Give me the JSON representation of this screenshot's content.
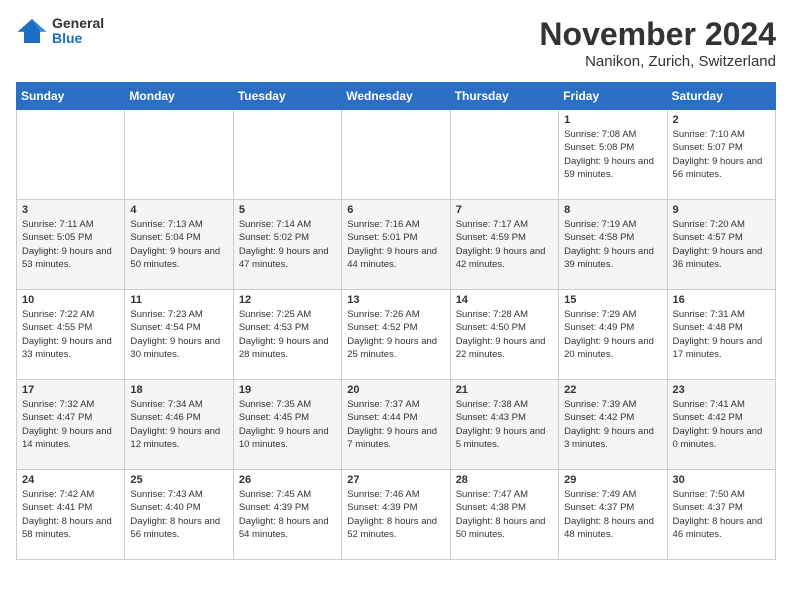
{
  "header": {
    "logo_general": "General",
    "logo_blue": "Blue",
    "month_title": "November 2024",
    "location": "Nanikon, Zurich, Switzerland"
  },
  "days_of_week": [
    "Sunday",
    "Monday",
    "Tuesday",
    "Wednesday",
    "Thursday",
    "Friday",
    "Saturday"
  ],
  "weeks": [
    [
      {
        "day": "",
        "sunrise": "",
        "sunset": "",
        "daylight": ""
      },
      {
        "day": "",
        "sunrise": "",
        "sunset": "",
        "daylight": ""
      },
      {
        "day": "",
        "sunrise": "",
        "sunset": "",
        "daylight": ""
      },
      {
        "day": "",
        "sunrise": "",
        "sunset": "",
        "daylight": ""
      },
      {
        "day": "",
        "sunrise": "",
        "sunset": "",
        "daylight": ""
      },
      {
        "day": "1",
        "sunrise": "Sunrise: 7:08 AM",
        "sunset": "Sunset: 5:08 PM",
        "daylight": "Daylight: 9 hours and 59 minutes."
      },
      {
        "day": "2",
        "sunrise": "Sunrise: 7:10 AM",
        "sunset": "Sunset: 5:07 PM",
        "daylight": "Daylight: 9 hours and 56 minutes."
      }
    ],
    [
      {
        "day": "3",
        "sunrise": "Sunrise: 7:11 AM",
        "sunset": "Sunset: 5:05 PM",
        "daylight": "Daylight: 9 hours and 53 minutes."
      },
      {
        "day": "4",
        "sunrise": "Sunrise: 7:13 AM",
        "sunset": "Sunset: 5:04 PM",
        "daylight": "Daylight: 9 hours and 50 minutes."
      },
      {
        "day": "5",
        "sunrise": "Sunrise: 7:14 AM",
        "sunset": "Sunset: 5:02 PM",
        "daylight": "Daylight: 9 hours and 47 minutes."
      },
      {
        "day": "6",
        "sunrise": "Sunrise: 7:16 AM",
        "sunset": "Sunset: 5:01 PM",
        "daylight": "Daylight: 9 hours and 44 minutes."
      },
      {
        "day": "7",
        "sunrise": "Sunrise: 7:17 AM",
        "sunset": "Sunset: 4:59 PM",
        "daylight": "Daylight: 9 hours and 42 minutes."
      },
      {
        "day": "8",
        "sunrise": "Sunrise: 7:19 AM",
        "sunset": "Sunset: 4:58 PM",
        "daylight": "Daylight: 9 hours and 39 minutes."
      },
      {
        "day": "9",
        "sunrise": "Sunrise: 7:20 AM",
        "sunset": "Sunset: 4:57 PM",
        "daylight": "Daylight: 9 hours and 36 minutes."
      }
    ],
    [
      {
        "day": "10",
        "sunrise": "Sunrise: 7:22 AM",
        "sunset": "Sunset: 4:55 PM",
        "daylight": "Daylight: 9 hours and 33 minutes."
      },
      {
        "day": "11",
        "sunrise": "Sunrise: 7:23 AM",
        "sunset": "Sunset: 4:54 PM",
        "daylight": "Daylight: 9 hours and 30 minutes."
      },
      {
        "day": "12",
        "sunrise": "Sunrise: 7:25 AM",
        "sunset": "Sunset: 4:53 PM",
        "daylight": "Daylight: 9 hours and 28 minutes."
      },
      {
        "day": "13",
        "sunrise": "Sunrise: 7:26 AM",
        "sunset": "Sunset: 4:52 PM",
        "daylight": "Daylight: 9 hours and 25 minutes."
      },
      {
        "day": "14",
        "sunrise": "Sunrise: 7:28 AM",
        "sunset": "Sunset: 4:50 PM",
        "daylight": "Daylight: 9 hours and 22 minutes."
      },
      {
        "day": "15",
        "sunrise": "Sunrise: 7:29 AM",
        "sunset": "Sunset: 4:49 PM",
        "daylight": "Daylight: 9 hours and 20 minutes."
      },
      {
        "day": "16",
        "sunrise": "Sunrise: 7:31 AM",
        "sunset": "Sunset: 4:48 PM",
        "daylight": "Daylight: 9 hours and 17 minutes."
      }
    ],
    [
      {
        "day": "17",
        "sunrise": "Sunrise: 7:32 AM",
        "sunset": "Sunset: 4:47 PM",
        "daylight": "Daylight: 9 hours and 14 minutes."
      },
      {
        "day": "18",
        "sunrise": "Sunrise: 7:34 AM",
        "sunset": "Sunset: 4:46 PM",
        "daylight": "Daylight: 9 hours and 12 minutes."
      },
      {
        "day": "19",
        "sunrise": "Sunrise: 7:35 AM",
        "sunset": "Sunset: 4:45 PM",
        "daylight": "Daylight: 9 hours and 10 minutes."
      },
      {
        "day": "20",
        "sunrise": "Sunrise: 7:37 AM",
        "sunset": "Sunset: 4:44 PM",
        "daylight": "Daylight: 9 hours and 7 minutes."
      },
      {
        "day": "21",
        "sunrise": "Sunrise: 7:38 AM",
        "sunset": "Sunset: 4:43 PM",
        "daylight": "Daylight: 9 hours and 5 minutes."
      },
      {
        "day": "22",
        "sunrise": "Sunrise: 7:39 AM",
        "sunset": "Sunset: 4:42 PM",
        "daylight": "Daylight: 9 hours and 3 minutes."
      },
      {
        "day": "23",
        "sunrise": "Sunrise: 7:41 AM",
        "sunset": "Sunset: 4:42 PM",
        "daylight": "Daylight: 9 hours and 0 minutes."
      }
    ],
    [
      {
        "day": "24",
        "sunrise": "Sunrise: 7:42 AM",
        "sunset": "Sunset: 4:41 PM",
        "daylight": "Daylight: 8 hours and 58 minutes."
      },
      {
        "day": "25",
        "sunrise": "Sunrise: 7:43 AM",
        "sunset": "Sunset: 4:40 PM",
        "daylight": "Daylight: 8 hours and 56 minutes."
      },
      {
        "day": "26",
        "sunrise": "Sunrise: 7:45 AM",
        "sunset": "Sunset: 4:39 PM",
        "daylight": "Daylight: 8 hours and 54 minutes."
      },
      {
        "day": "27",
        "sunrise": "Sunrise: 7:46 AM",
        "sunset": "Sunset: 4:39 PM",
        "daylight": "Daylight: 8 hours and 52 minutes."
      },
      {
        "day": "28",
        "sunrise": "Sunrise: 7:47 AM",
        "sunset": "Sunset: 4:38 PM",
        "daylight": "Daylight: 8 hours and 50 minutes."
      },
      {
        "day": "29",
        "sunrise": "Sunrise: 7:49 AM",
        "sunset": "Sunset: 4:37 PM",
        "daylight": "Daylight: 8 hours and 48 minutes."
      },
      {
        "day": "30",
        "sunrise": "Sunrise: 7:50 AM",
        "sunset": "Sunset: 4:37 PM",
        "daylight": "Daylight: 8 hours and 46 minutes."
      }
    ]
  ]
}
